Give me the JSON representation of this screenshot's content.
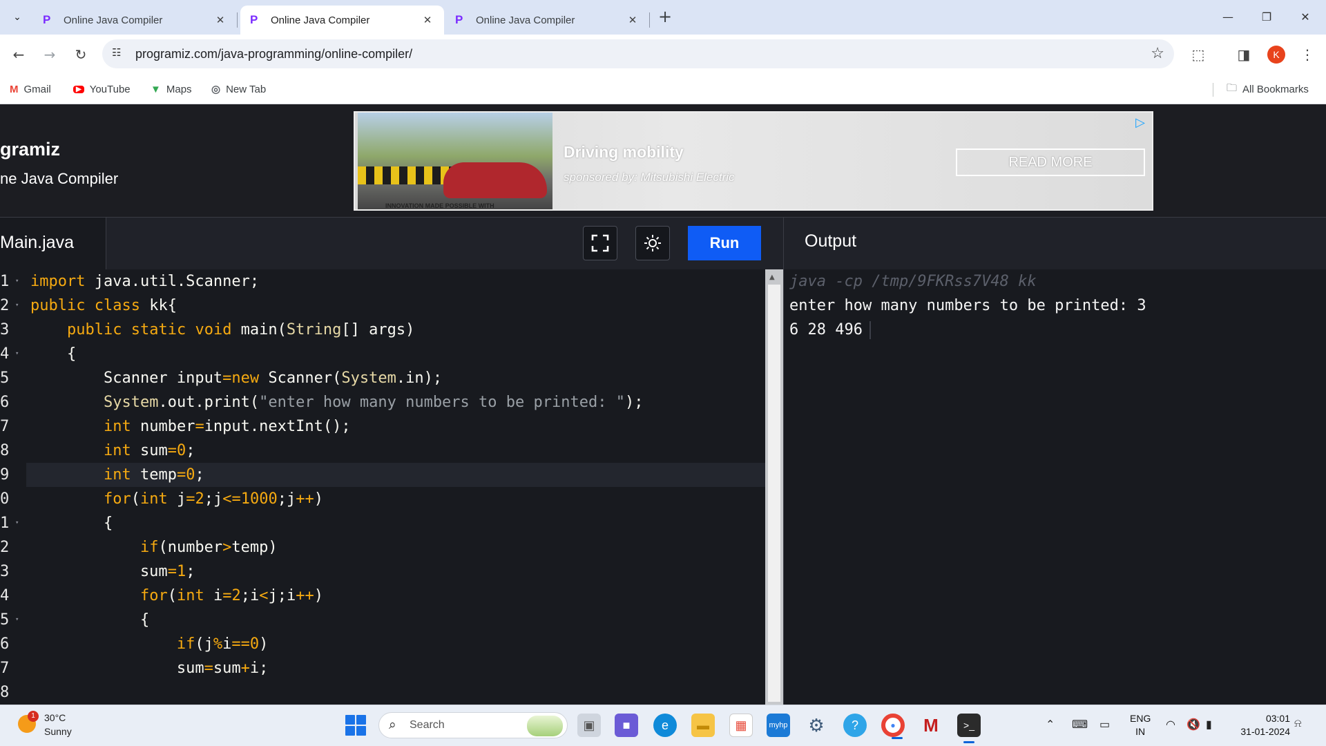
{
  "browser": {
    "tabs": [
      {
        "label": "Online Java Compiler",
        "active": false
      },
      {
        "label": "Online Java Compiler",
        "active": true
      },
      {
        "label": "Online Java Compiler",
        "active": false
      }
    ],
    "url": "programiz.com/java-programming/online-compiler/",
    "profile_initial": "K",
    "bookmarks": [
      {
        "label": "Gmail",
        "icon": "gmail-icon"
      },
      {
        "label": "YouTube",
        "icon": "youtube-icon"
      },
      {
        "label": "Maps",
        "icon": "maps-icon"
      },
      {
        "label": "New Tab",
        "icon": "globe-icon"
      }
    ],
    "all_bookmarks": "All Bookmarks"
  },
  "site": {
    "brand": "gramiz",
    "subtitle": "ne Java Compiler"
  },
  "ad": {
    "image_caption": "INNOVATION MADE POSSIBLE WITH",
    "title": "Driving mobility",
    "sponsor": "sponsored by: Mitsubishi Electric",
    "button": "READ MORE"
  },
  "editor": {
    "file_tab": "Main.java",
    "run_label": "Run",
    "line_numbers": [
      "1",
      "2",
      "3",
      "4",
      "5",
      "6",
      "7",
      "8",
      "9",
      "0",
      "1",
      "2",
      "3",
      "4",
      "5",
      "6",
      "7",
      "8"
    ],
    "folds": [
      true,
      true,
      false,
      true,
      false,
      false,
      false,
      false,
      false,
      false,
      true,
      false,
      false,
      false,
      true,
      false,
      false,
      false
    ],
    "active_line": 9
  },
  "output": {
    "title": "Output",
    "command": "java -cp /tmp/9FKRss7V48 kk",
    "lines": [
      "enter how many numbers to be printed: 3",
      "6 28 496"
    ]
  },
  "taskbar": {
    "temp": "30°C",
    "condition": "Sunny",
    "weather_badge": "1",
    "search_placeholder": "Search",
    "lang_top": "ENG",
    "lang_bottom": "IN",
    "time": "03:01",
    "date": "31-01-2024",
    "apps": [
      "file-explorer-icon",
      "meet-icon",
      "edge-icon",
      "folder-icon",
      "store-icon",
      "myhp-icon",
      "settings-icon",
      "copilot-icon",
      "chrome-icon",
      "mcafee-icon",
      "terminal-icon"
    ]
  },
  "colors": {
    "run_button": "#0f5cf5",
    "keyword": "#f6aa11",
    "string": "#9aa0a6",
    "editor_bg": "#181a1f"
  }
}
